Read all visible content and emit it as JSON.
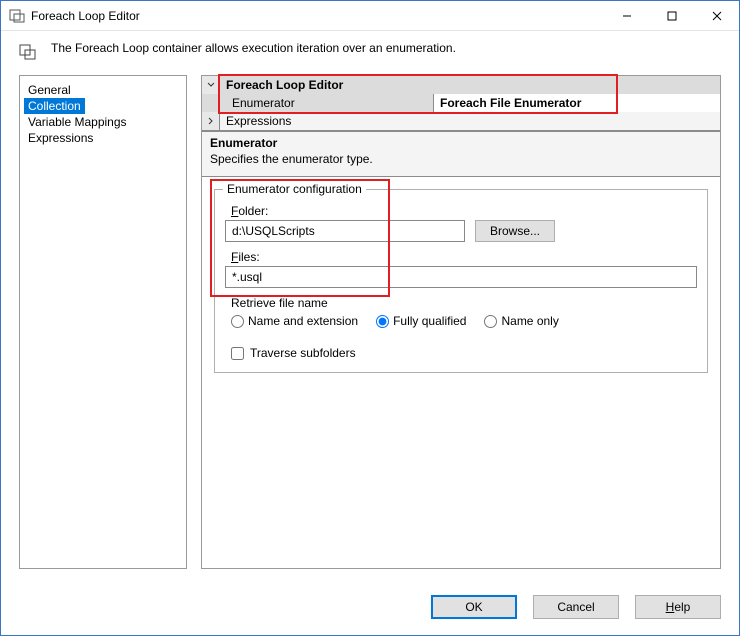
{
  "titlebar": {
    "title": "Foreach Loop Editor"
  },
  "header": {
    "text": "The Foreach Loop container allows execution iteration over an enumeration."
  },
  "nav": {
    "items": [
      {
        "label": "General"
      },
      {
        "label": "Collection"
      },
      {
        "label": "Variable Mappings"
      },
      {
        "label": "Expressions"
      }
    ]
  },
  "grid": {
    "section_title": "Foreach Loop Editor",
    "row_enumerator_label": "Enumerator",
    "row_enumerator_value": "Foreach File Enumerator",
    "row_expressions_label": "Expressions"
  },
  "desc": {
    "title": "Enumerator",
    "text": "Specifies the enumerator type."
  },
  "config": {
    "legend": "Enumerator configuration",
    "folder_label_pre": "F",
    "folder_label_rest": "older:",
    "folder_value": "d:\\USQLScripts",
    "browse_label": "Browse...",
    "files_label_pre": "F",
    "files_label_rest": "iles:",
    "files_value": "*.usql",
    "retrieve_label": "Retrieve file name",
    "opt1_pre": "Name and e",
    "opt1_ul": "x",
    "opt1_post": "tension",
    "opt2_ul": "F",
    "opt2_post": "ully qualified",
    "opt3_ul": "N",
    "opt3_post": "ame only",
    "traverse_ul": "T",
    "traverse_post": "raverse subfolders"
  },
  "buttons": {
    "ok": "OK",
    "cancel": "Cancel",
    "help_ul": "H",
    "help_post": "elp"
  }
}
